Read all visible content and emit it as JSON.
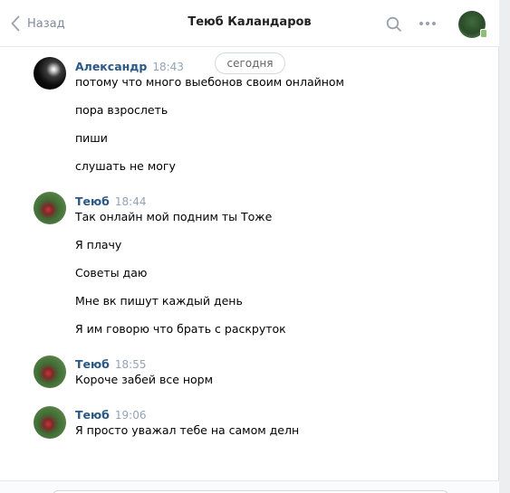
{
  "header": {
    "back_label": "Назад",
    "title": "Теюб Каландаров"
  },
  "date_separator": "сегодня",
  "groups": [
    {
      "author": "Александр",
      "time": "18:43",
      "messages": [
        "потому что много выебонов своим онлайном",
        "пора взрослеть",
        "пиши",
        "слушать не могу"
      ]
    },
    {
      "author": "Теюб",
      "time": "18:44",
      "messages": [
        "Так онлайн мой подним ты Тоже",
        "Я плачу",
        "Советы даю",
        "Мне вк пишут каждый день",
        "Я им говорю что брать с раскруток"
      ]
    },
    {
      "author": "Теюб",
      "time": "18:55",
      "messages": [
        "Короче забей все норм"
      ]
    },
    {
      "author": "Теюб",
      "time": "19:06",
      "messages": [
        "Я просто уважал тебе на самом делн"
      ]
    }
  ],
  "icons": {
    "back": "chevron-left-icon",
    "search": "search-icon",
    "more": "more-dots-icon"
  },
  "colors": {
    "author_name": "#2a5885",
    "timestamp": "#93a3b8",
    "online": "#8ac176"
  }
}
